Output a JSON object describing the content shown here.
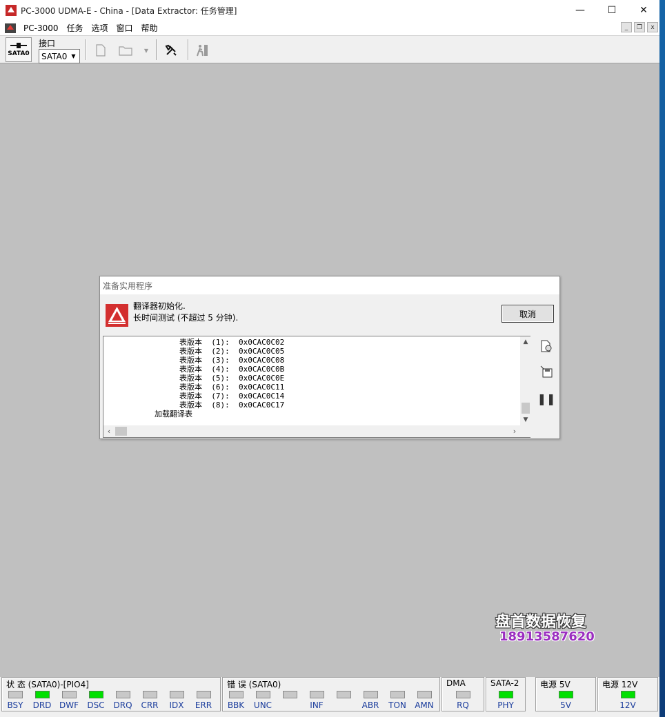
{
  "window": {
    "title": "PC-3000 UDMA-E - China - [Data Extractor: 任务管理]",
    "minimize": "—",
    "maximize": "☐",
    "close": "✕"
  },
  "menu": {
    "items": [
      "PC-3000",
      "任务",
      "选项",
      "窗口",
      "帮助"
    ],
    "mdi_minimize": "_",
    "mdi_restore": "❐",
    "mdi_close": "x"
  },
  "toolbar": {
    "sata_label": "SATA0",
    "interface_label": "接口",
    "interface_value": "SATA0"
  },
  "dialog": {
    "title": "准备实用程序",
    "message1": "翻译器初始化.",
    "message2": "长时间测试 (不超过 5 分钟).",
    "cancel": "取消",
    "log": [
      "表版本  (1):  0x0CAC0C02",
      "表版本  (2):  0x0CAC0C05",
      "表版本  (3):  0x0CAC0C08",
      "表版本  (4):  0x0CAC0C0B",
      "表版本  (5):  0x0CAC0C0E",
      "表版本  (6):  0x0CAC0C11",
      "表版本  (7):  0x0CAC0C14",
      "表版本  (8):  0x0CAC0C17",
      "加载翻译表"
    ]
  },
  "watermark": {
    "line1": "盘首数据恢复",
    "line2": "18913587620"
  },
  "status": {
    "state_title": "状 态 (SATA0)-[PIO4]",
    "state_leds": [
      {
        "label": "BSY",
        "on": false
      },
      {
        "label": "DRD",
        "on": true
      },
      {
        "label": "DWF",
        "on": false
      },
      {
        "label": "DSC",
        "on": true
      },
      {
        "label": "DRQ",
        "on": false
      },
      {
        "label": "CRR",
        "on": false
      },
      {
        "label": "IDX",
        "on": false
      },
      {
        "label": "ERR",
        "on": false
      }
    ],
    "error_title": "错 误 (SATA0)",
    "error_leds": [
      {
        "label": "BBK",
        "on": false
      },
      {
        "label": "UNC",
        "on": false
      },
      {
        "label": "",
        "on": false
      },
      {
        "label": "INF",
        "on": false
      },
      {
        "label": "",
        "on": false
      },
      {
        "label": "ABR",
        "on": false
      },
      {
        "label": "TON",
        "on": false
      },
      {
        "label": "AMN",
        "on": false
      }
    ],
    "dma_title": "DMA",
    "dma_led": {
      "label": "RQ",
      "on": false
    },
    "sata2_title": "SATA-2",
    "sata2_led": {
      "label": "PHY",
      "on": true
    },
    "p5_title": "电源 5V",
    "p5_led": {
      "label": "5V",
      "on": true
    },
    "p12_title": "电源 12V",
    "p12_led": {
      "label": "12V",
      "on": true
    },
    "led_on_color": "#00e000",
    "led_off_color": "#c8c8c8"
  }
}
